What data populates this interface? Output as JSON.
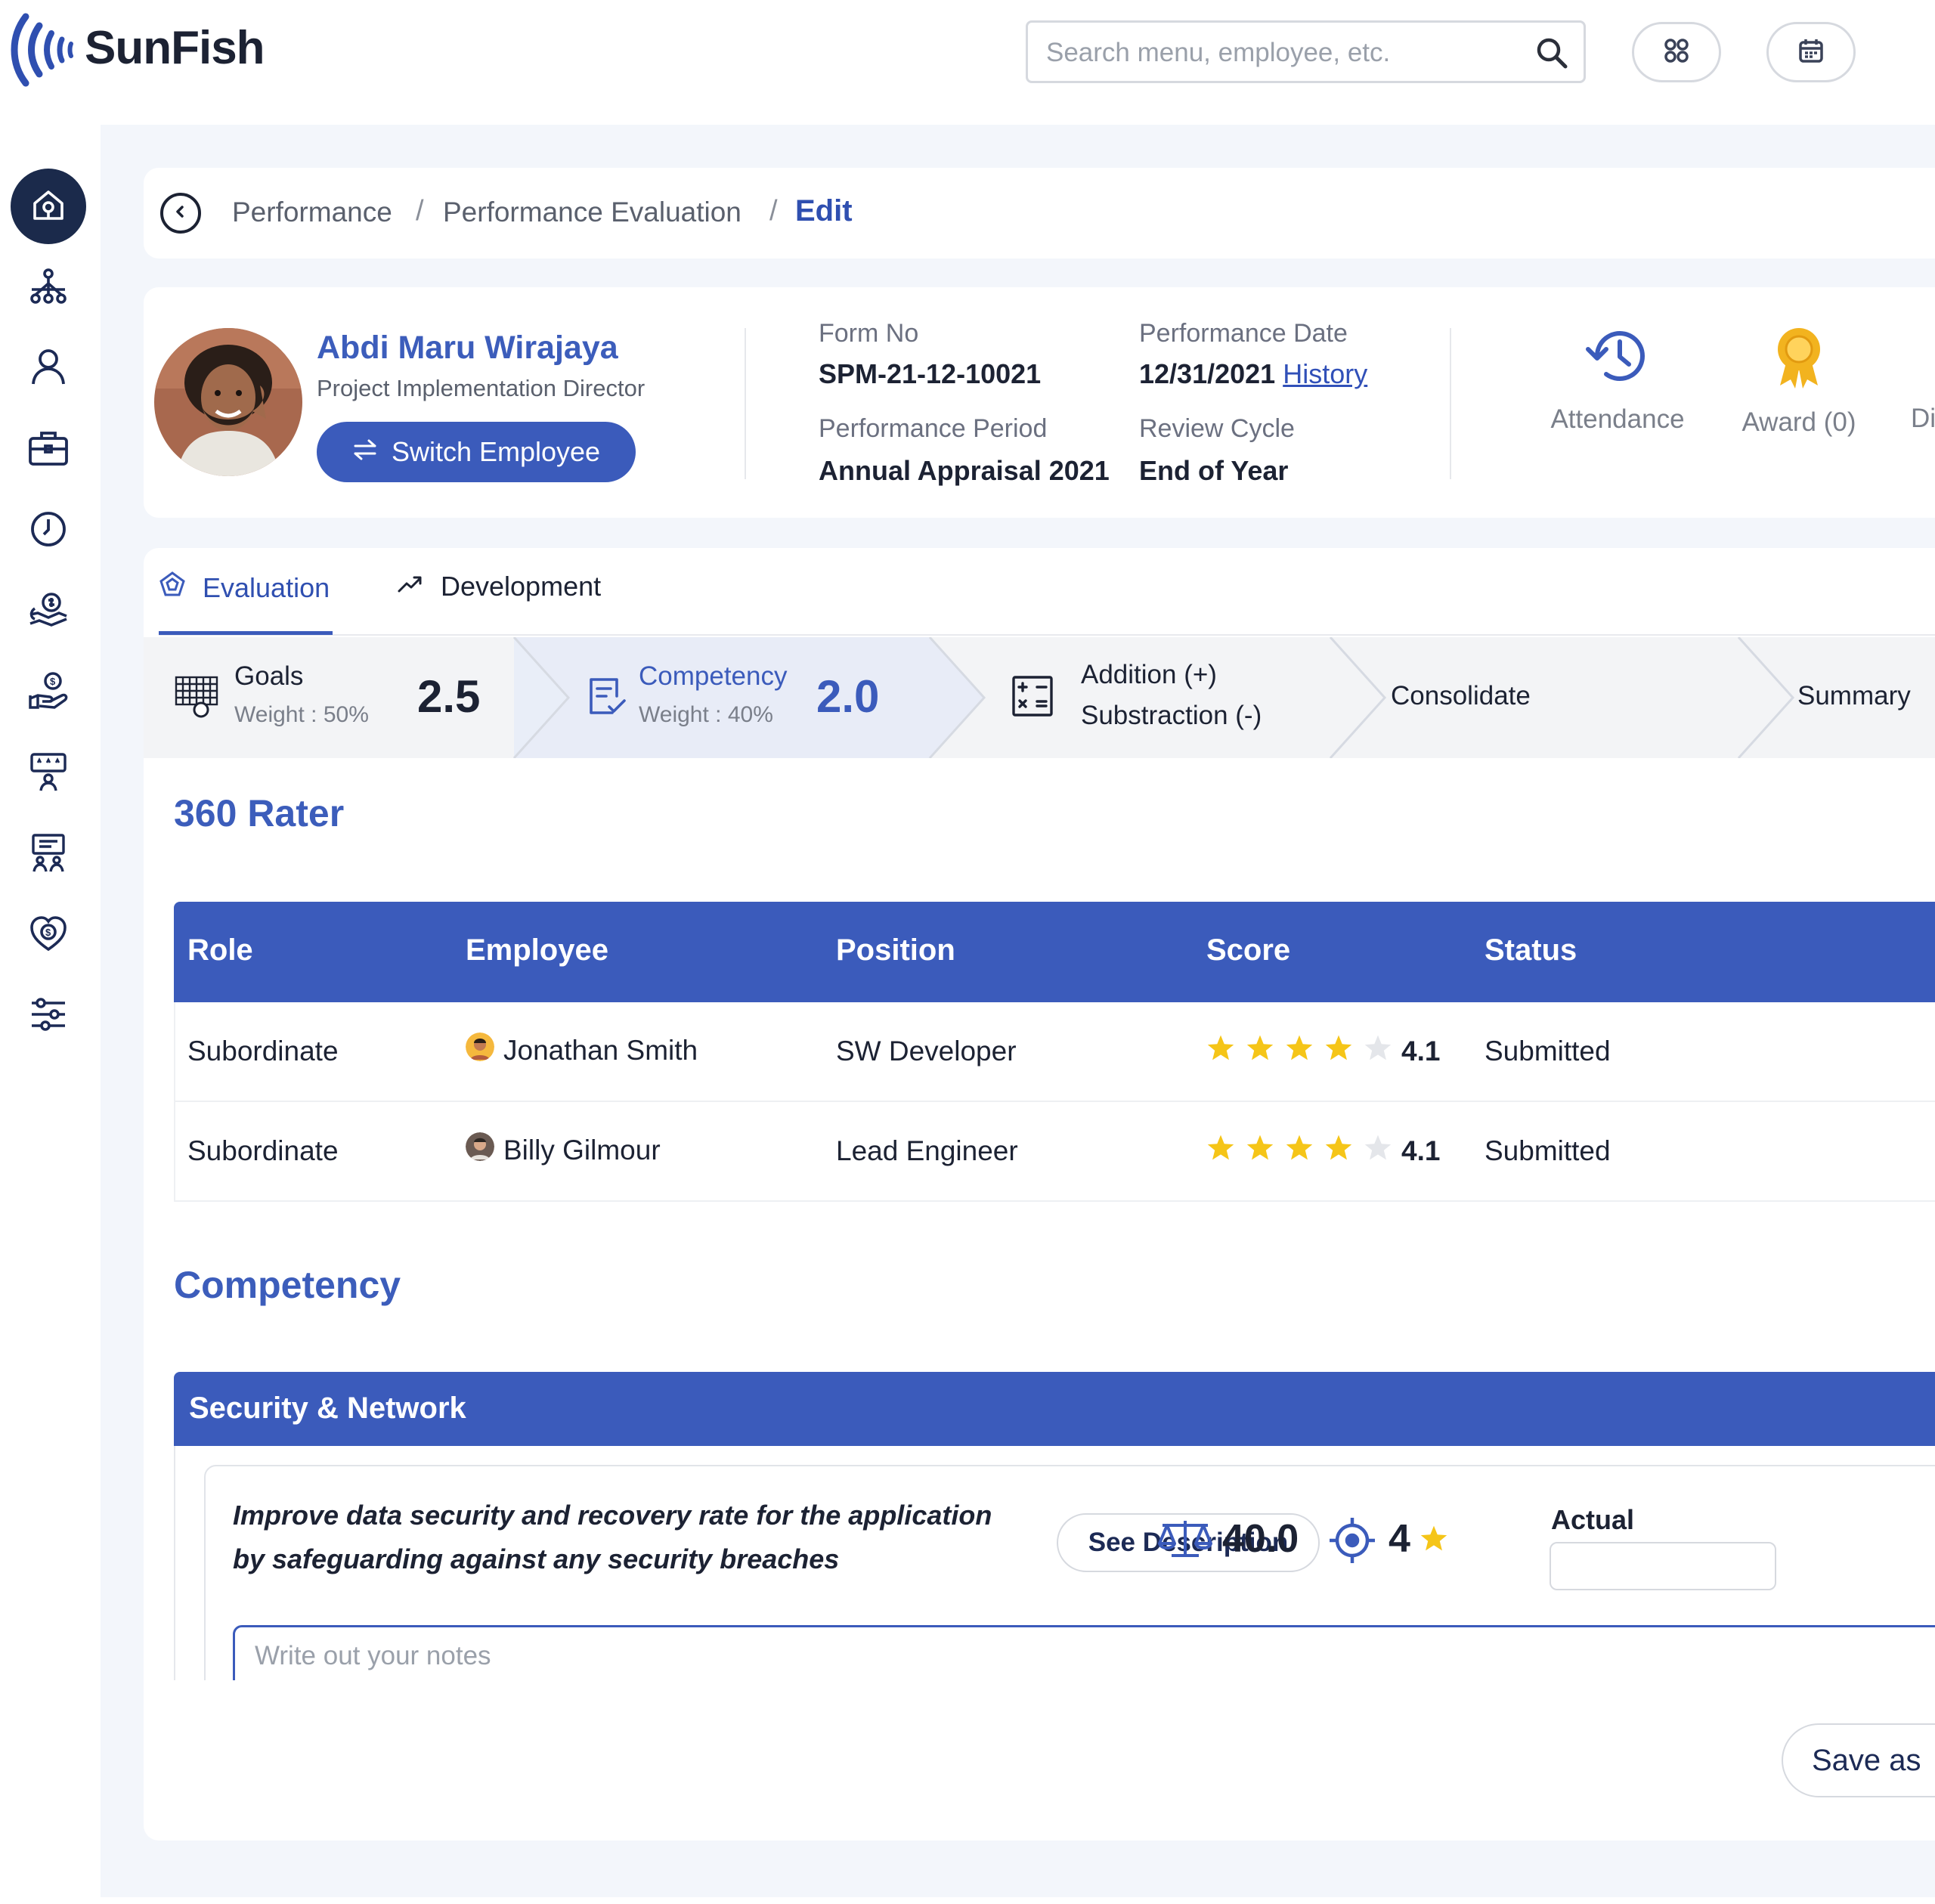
{
  "app": {
    "name": "SunFish",
    "search_placeholder": "Search menu, employee, etc."
  },
  "icons": {
    "logo": "sunfish-logo-icon",
    "search": "search-icon",
    "apps": "apps-grid-icon",
    "calendar": "calendar-icon",
    "back": "chevron-left-icon",
    "switch": "swap-arrows-icon",
    "attendance": "history-clock-icon",
    "award": "award-ribbon-icon"
  },
  "colors": {
    "primary": "#3b5bbb",
    "title_blue": "#3c5dbb",
    "link_blue": "#3150b8",
    "star": "#f5c518",
    "star_empty": "#e4e6ea",
    "sidebar_active": "#1b2a4b",
    "award_gold": "#f2b31f"
  },
  "sidebar": {
    "items": [
      {
        "name": "home-icon",
        "active": true
      },
      {
        "name": "org-structure-icon"
      },
      {
        "name": "user-icon"
      },
      {
        "name": "briefcase-icon"
      },
      {
        "name": "clock-icon"
      },
      {
        "name": "hand-money-icon"
      },
      {
        "name": "hand-coin-icon"
      },
      {
        "name": "training-board-icon"
      },
      {
        "name": "presentation-icon"
      },
      {
        "name": "heart-coin-icon"
      },
      {
        "name": "settings-sliders-icon"
      }
    ]
  },
  "breadcrumb": {
    "items": [
      "Performance",
      "Performance Evaluation"
    ],
    "current": "Edit",
    "separator": "/"
  },
  "employee": {
    "name": "Abdi Maru Wirajaya",
    "title": "Project Implementation Director",
    "switch_label": "Switch Employee"
  },
  "form": {
    "form_no_label": "Form No",
    "form_no": "SPM-21-12-10021",
    "performance_date_label": "Performance Date",
    "performance_date": "12/31/2021",
    "history_link": "History",
    "performance_period_label": "Performance Period",
    "performance_period": "Annual Appraisal 2021",
    "review_cycle_label": "Review Cycle",
    "review_cycle": "End of Year"
  },
  "quick_links": {
    "attendance": "Attendance",
    "award": "Award (0)",
    "third": "Di"
  },
  "tabs": {
    "evaluation": "Evaluation",
    "development": "Development"
  },
  "steps": {
    "goals": {
      "name": "Goals",
      "weight": "Weight : 50%",
      "score": "2.5"
    },
    "competency": {
      "name": "Competency",
      "weight": "Weight : 40%",
      "score": "2.0"
    },
    "addition": {
      "line1": "Addition (+)",
      "line2": "Substraction (-)"
    },
    "consolidate": "Consolidate",
    "summary": "Summary"
  },
  "rater": {
    "title": "360 Rater",
    "headers": [
      "Role",
      "Employee",
      "Position",
      "Score",
      "Status"
    ],
    "rows": [
      {
        "role": "Subordinate",
        "employee": "Jonathan Smith",
        "position": "SW Developer",
        "stars": 4,
        "score": "4.1",
        "status": "Submitted"
      },
      {
        "role": "Subordinate",
        "employee": "Billy Gilmour",
        "position": "Lead Engineer",
        "stars": 4,
        "score": "4.1",
        "status": "Submitted"
      }
    ]
  },
  "competency": {
    "title": "Competency",
    "group": "Security & Network",
    "item": {
      "description": "Improve data security and recovery rate for the application by safeguarding against any security breaches",
      "see_description": "See Description",
      "weight": "40.0",
      "target": "4",
      "actual_label": "Actual",
      "notes_placeholder": "Write out your notes"
    }
  },
  "actions": {
    "save_label": "Save as"
  }
}
